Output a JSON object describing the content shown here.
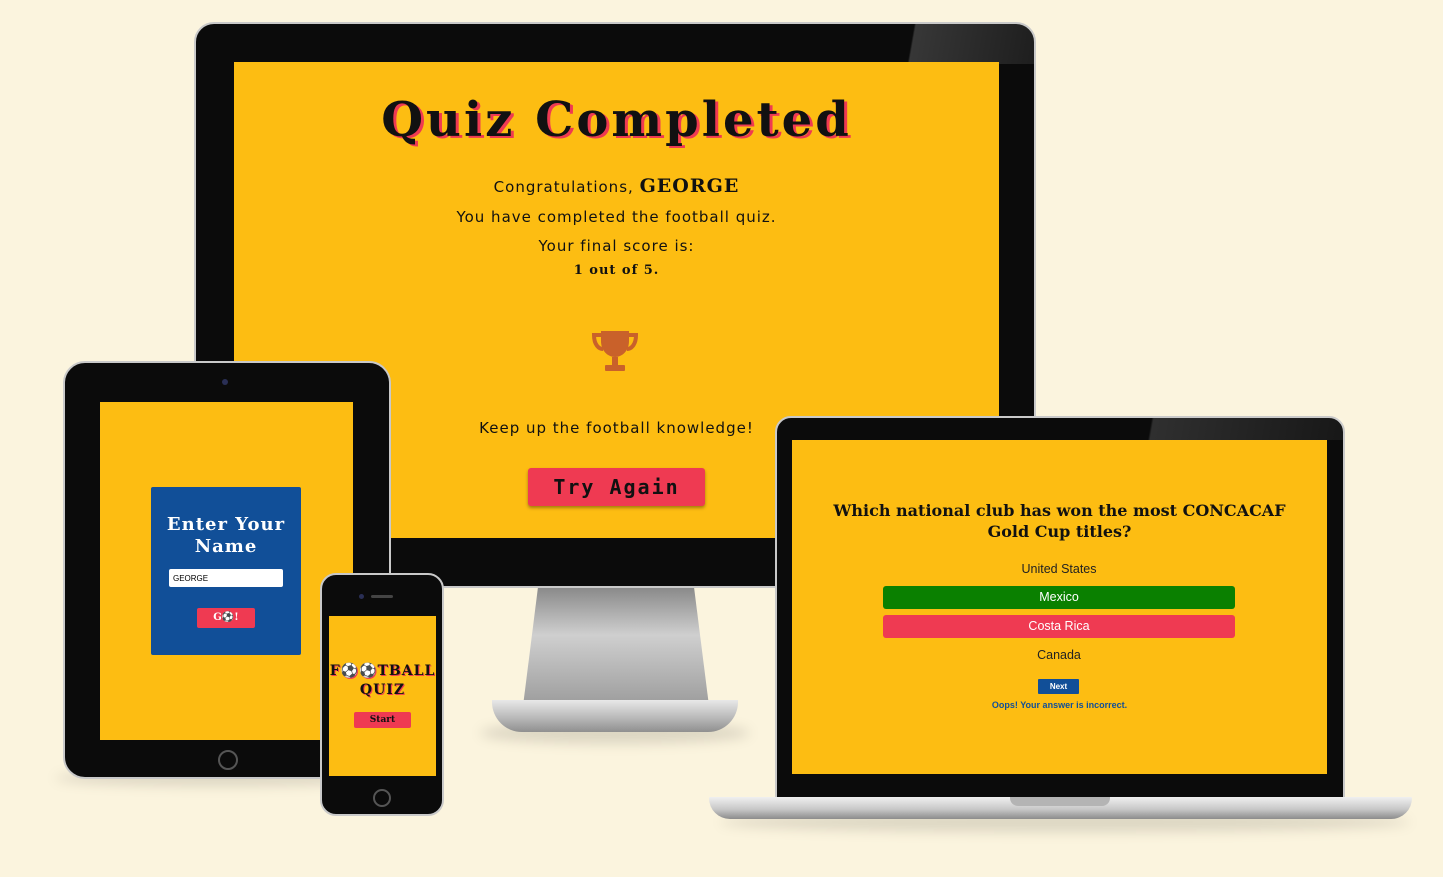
{
  "desktop": {
    "title": "Quiz Completed",
    "congrats_prefix": "Congratulations,",
    "player_name": "GEORGE",
    "completed_text": "You have completed the football quiz.",
    "score_label": "Your final score is:",
    "score_value": "1 out of 5.",
    "trophy_icon": "trophy-icon",
    "encouragement": "Keep up the football knowledge!",
    "try_again_label": "Try Again"
  },
  "tablet": {
    "card_title": "Enter Your Name",
    "name_value": "GEORGE",
    "go_label": "G⚽!"
  },
  "phone": {
    "title_line1": "F⚽⚽TBALL",
    "title_line2": "QUIZ",
    "start_label": "Start"
  },
  "laptop": {
    "question": "Which national club has won the most CONCACAF Gold Cup titles?",
    "options": [
      {
        "label": "United States",
        "state": "neutral"
      },
      {
        "label": "Mexico",
        "state": "correct"
      },
      {
        "label": "Costa Rica",
        "state": "incorrect"
      },
      {
        "label": "Canada",
        "state": "neutral"
      }
    ],
    "next_label": "Next",
    "feedback": "Oops! Your answer is incorrect."
  },
  "colors": {
    "page_background": "#fbf4de",
    "screen_yellow": "#fdbd12",
    "accent_red": "#ef3a52",
    "brand_blue": "#114f98",
    "correct_green": "#0a8000"
  }
}
